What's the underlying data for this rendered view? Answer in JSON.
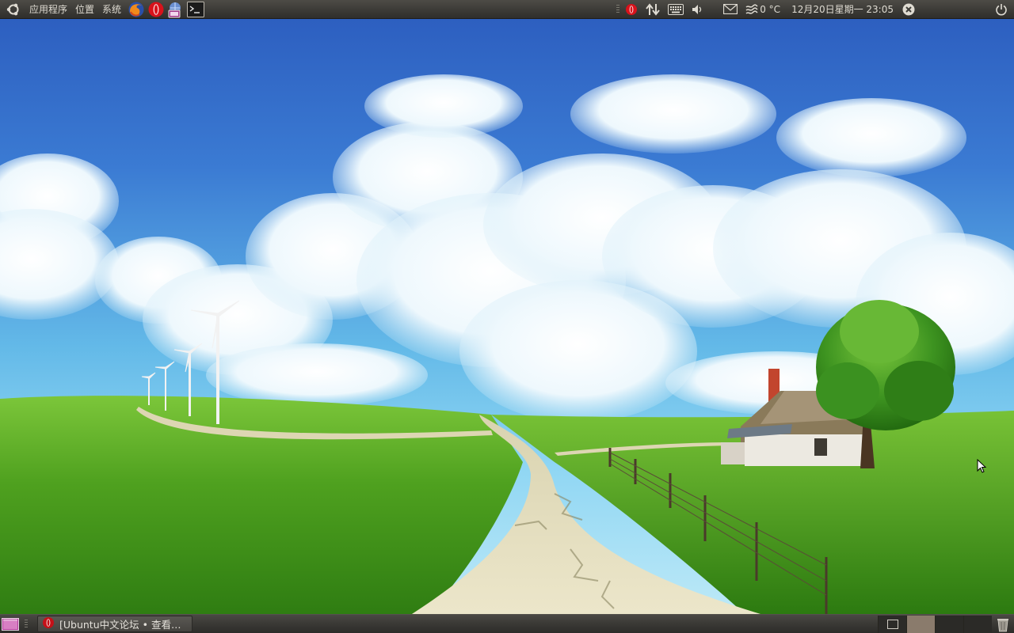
{
  "top_panel": {
    "menus": [
      "应用程序",
      "位置",
      "系统"
    ],
    "launchers": [
      "firefox-icon",
      "opera-icon",
      "network-manager-icon",
      "terminal-icon"
    ],
    "tray": {
      "weather": "0 °C",
      "clock": "12月20日星期一 23:05"
    }
  },
  "bottom_panel": {
    "task": "[Ubuntu中文论坛 • 查看…",
    "workspace_count": 4,
    "active_workspace": 1
  },
  "colors": {
    "panel": "#3c3b37",
    "panel_text": "#dfdbd2",
    "sky": "#3a6fc6",
    "grass": "#5aa82a",
    "road": "#e6dfbf"
  }
}
